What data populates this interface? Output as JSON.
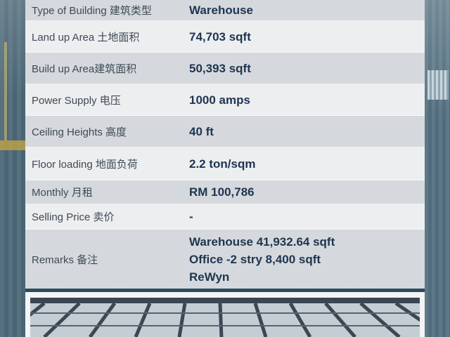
{
  "rows": [
    {
      "label": "Type of Building 建筑类型",
      "value": "Warehouse"
    },
    {
      "label": "Land up Area 土地面积",
      "value": "74,703 sqft"
    },
    {
      "label": "Build up Area建筑面积",
      "value": "50,393 sqft"
    },
    {
      "label": "Power Supply 电压",
      "value": "1000 amps"
    },
    {
      "label": "Ceiling Heights 高度",
      "value": "40 ft"
    },
    {
      "label": "Floor loading 地面负荷",
      "value": "2.2 ton/sqm"
    },
    {
      "label": "Monthly 月租",
      "value": "RM 100,786"
    },
    {
      "label": "Selling Price 卖价",
      "value": "-"
    },
    {
      "label": "Remarks 备注",
      "value_lines": [
        "Warehouse 41,932.64 sqft",
        "Office -2 stry 8,400 sqft",
        "ReWyn"
      ]
    }
  ],
  "colors": {
    "row_odd": "#d5d9dd",
    "row_even": "#eceef0",
    "value_text": "#1f3550",
    "label_text": "#3f4a55"
  }
}
